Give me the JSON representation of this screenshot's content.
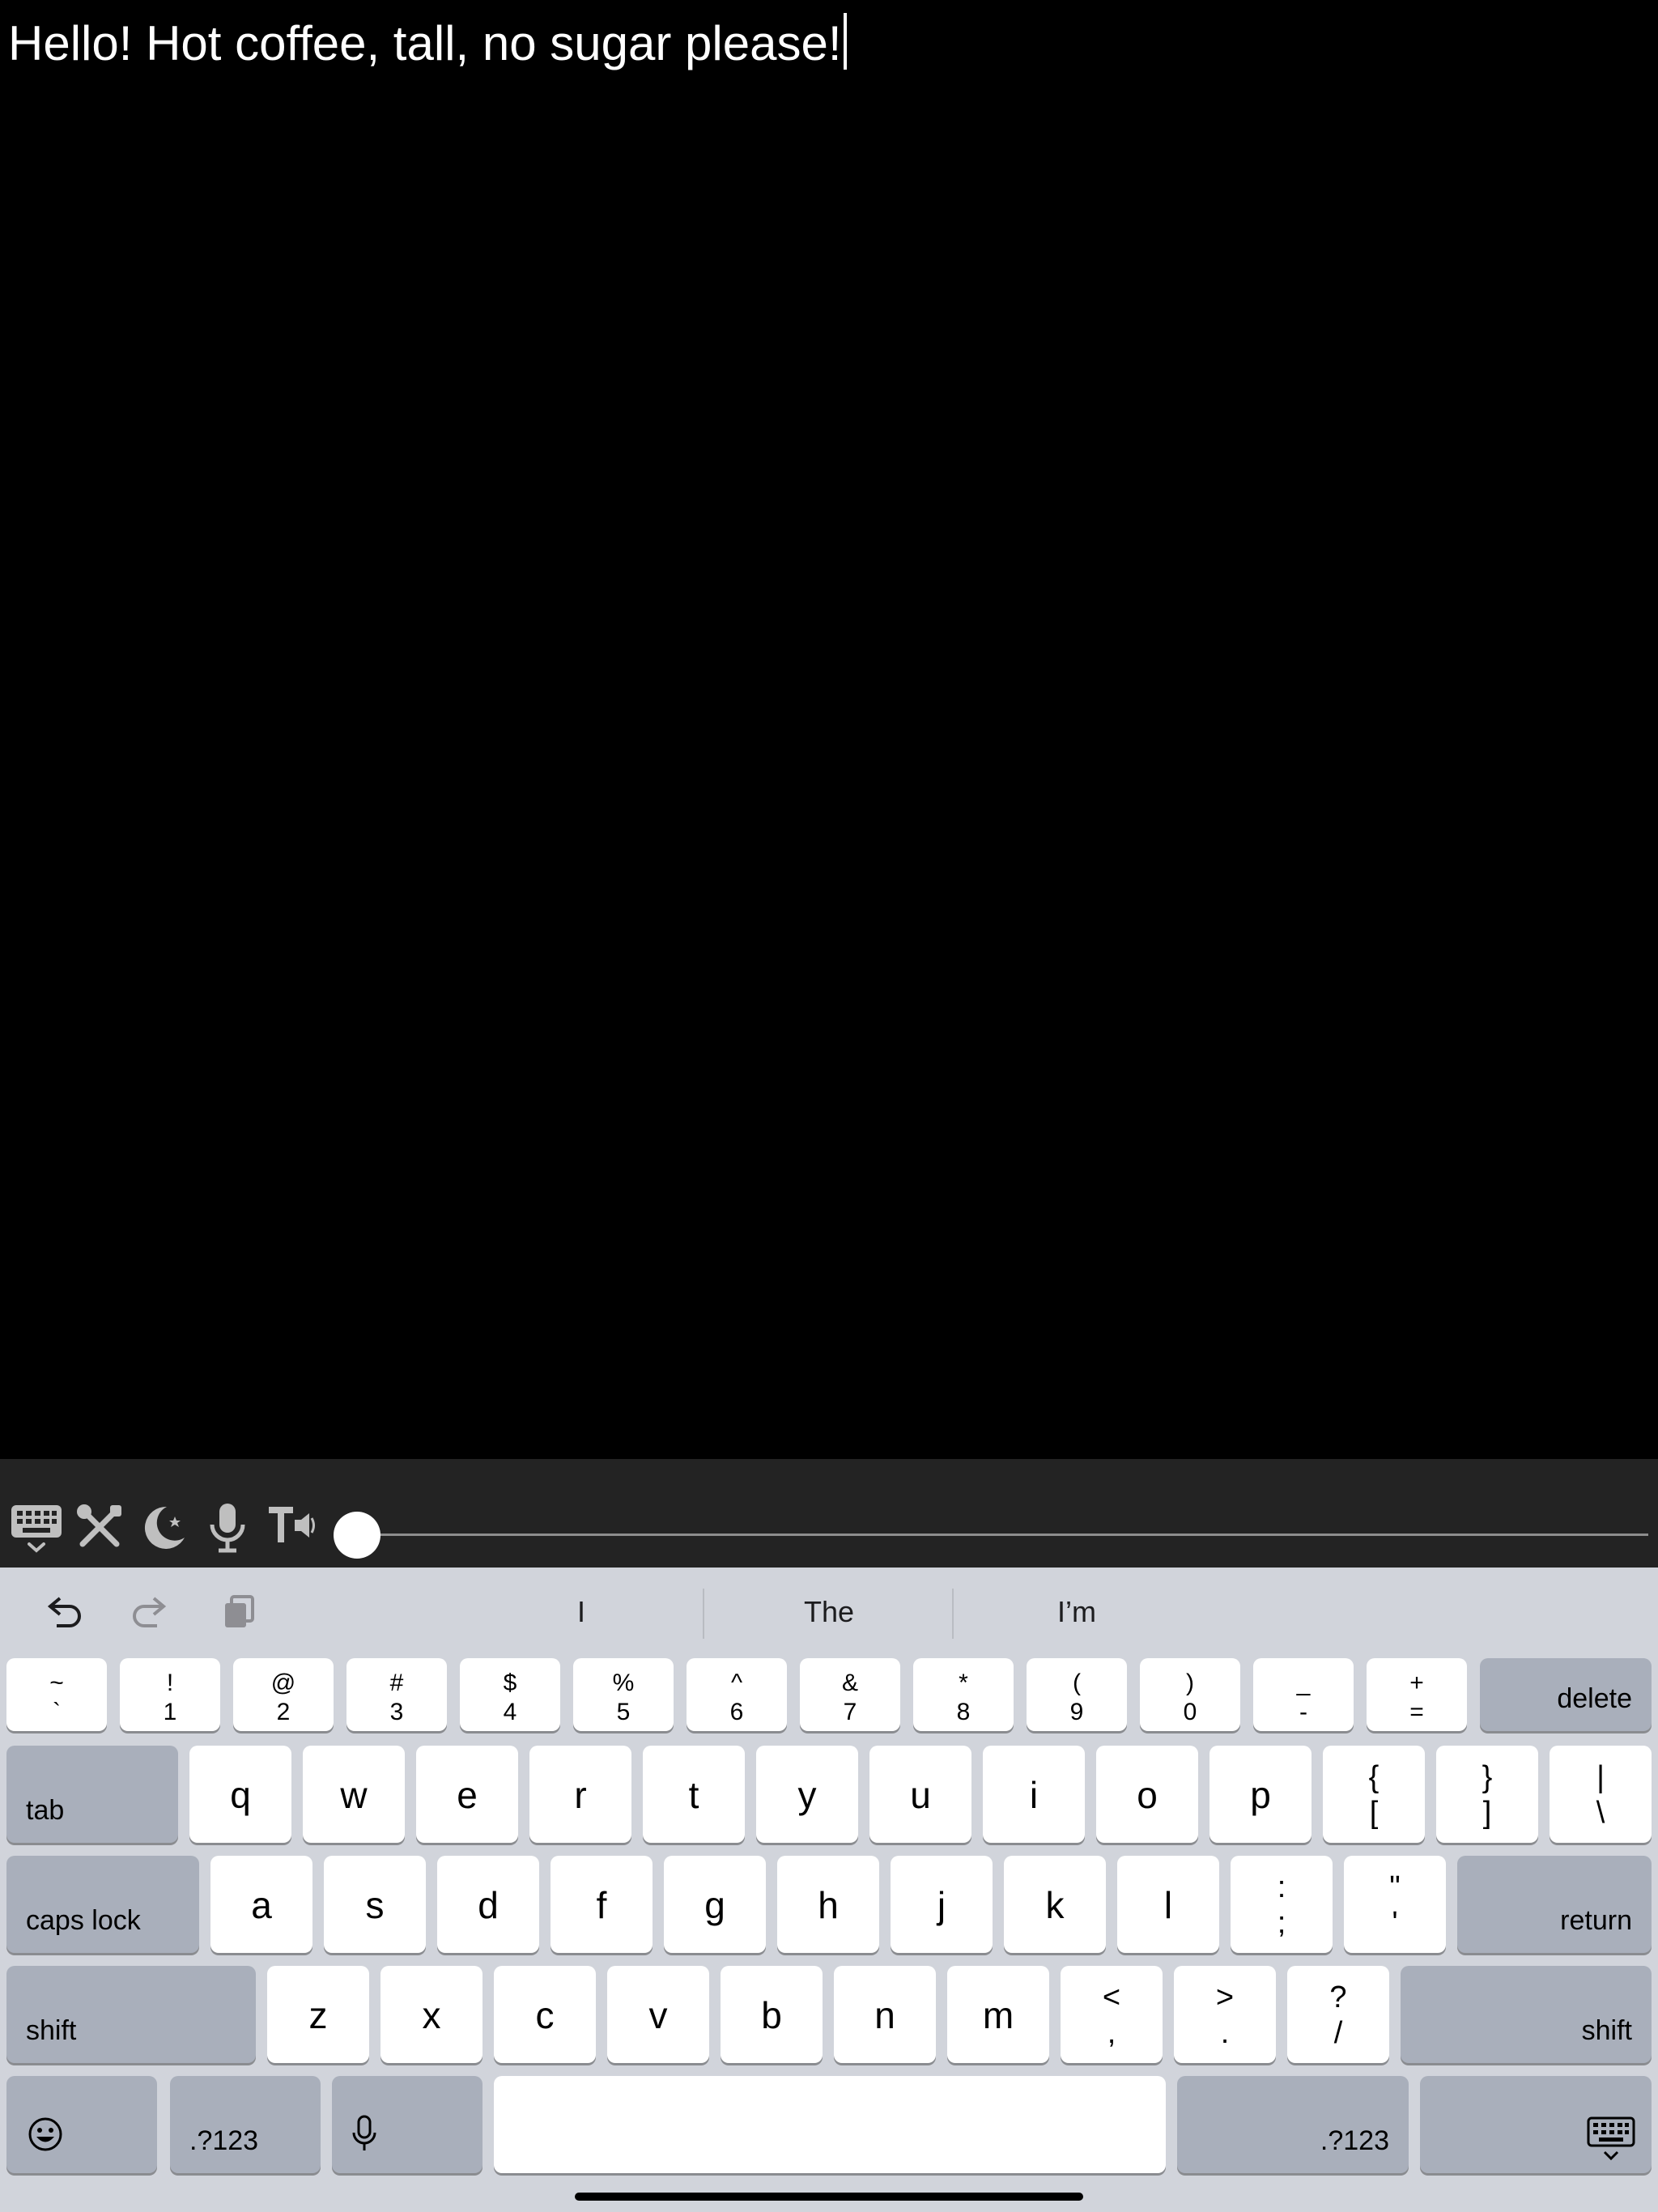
{
  "editor": {
    "text": "Hello! Hot coffee, tall, no sugar please!"
  },
  "toolbar": {
    "icons": [
      "keyboard-hide-icon",
      "tools-icon",
      "night-mode-icon",
      "microphone-icon",
      "text-to-speech-icon"
    ],
    "slider_level": 0
  },
  "suggestions": {
    "items": [
      "I",
      "The",
      "I’m"
    ]
  },
  "keyboard": {
    "number_row": [
      {
        "top": "~",
        "bottom": "`"
      },
      {
        "top": "!",
        "bottom": "1"
      },
      {
        "top": "@",
        "bottom": "2"
      },
      {
        "top": "#",
        "bottom": "3"
      },
      {
        "top": "$",
        "bottom": "4"
      },
      {
        "top": "%",
        "bottom": "5"
      },
      {
        "top": "^",
        "bottom": "6"
      },
      {
        "top": "&",
        "bottom": "7"
      },
      {
        "top": "*",
        "bottom": "8"
      },
      {
        "top": "(",
        "bottom": "9"
      },
      {
        "top": ")",
        "bottom": "0"
      },
      {
        "top": "_",
        "bottom": "-"
      },
      {
        "top": "+",
        "bottom": "="
      }
    ],
    "delete_label": "delete",
    "tab_label": "tab",
    "qwerty_row": [
      "q",
      "w",
      "e",
      "r",
      "t",
      "y",
      "u",
      "i",
      "o",
      "p"
    ],
    "qwerty_symbols": [
      {
        "top": "{",
        "bottom": "["
      },
      {
        "top": "}",
        "bottom": "]"
      },
      {
        "top": "|",
        "bottom": "\\"
      }
    ],
    "caps_label": "caps lock",
    "home_row": [
      "a",
      "s",
      "d",
      "f",
      "g",
      "h",
      "j",
      "k",
      "l"
    ],
    "home_symbols": [
      {
        "top": ":",
        "bottom": ";"
      },
      {
        "top": "\"",
        "bottom": "'"
      }
    ],
    "return_label": "return",
    "shift_label": "shift",
    "bottom_row": [
      "z",
      "x",
      "c",
      "v",
      "b",
      "n",
      "m"
    ],
    "bottom_symbols": [
      {
        "top": "<",
        "bottom": ","
      },
      {
        "top": ">",
        "bottom": "."
      },
      {
        "top": "?",
        "bottom": "/"
      }
    ],
    "numbers_label": ".?123"
  }
}
